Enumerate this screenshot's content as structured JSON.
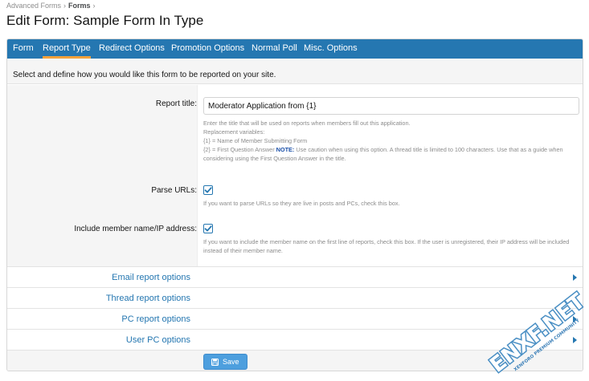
{
  "breadcrumb": {
    "items": [
      "Advanced Forms",
      "Forms"
    ],
    "separator": "›"
  },
  "page": {
    "title": "Edit Form: Sample Form In Type"
  },
  "tabs": [
    {
      "label": "Form",
      "active": false
    },
    {
      "label": "Report Type",
      "active": true
    },
    {
      "label": "Redirect Options",
      "active": false
    },
    {
      "label": "Promotion Options",
      "active": false
    },
    {
      "label": "Normal Poll",
      "active": false
    },
    {
      "label": "Misc. Options",
      "active": false
    }
  ],
  "intro_text": "Select and define how you would like this form to be reported on your site.",
  "report_title": {
    "label": "Report title:",
    "value": "Moderator Application from {1}",
    "explain_line1": "Enter the title that will be used on reports when members fill out this application.",
    "explain_line2": "Replacement variables:",
    "explain_line3": "{1} = Name of Member Submitting Form",
    "explain_line4_pre": "{2} = First Question Answer ",
    "explain_note": "NOTE:",
    "explain_line4_post": " Use caution when using this option. A thread title is limited to 100 characters. Use that as a guide when considering using the First Question Answer in the title."
  },
  "parse_urls": {
    "label": "Parse URLs:",
    "checked": true,
    "explain": "If you want to parse URLs so they are live in posts and PCs, check this box."
  },
  "include_member": {
    "label": "Include member name/IP address:",
    "checked": true,
    "explain": "If you want to include the member name on the first line of reports, check this box. If the user is unregistered, their IP address will be included instead of their member name."
  },
  "collapsers": [
    {
      "label": "Email report options"
    },
    {
      "label": "Thread report options"
    },
    {
      "label": "PC report options"
    },
    {
      "label": "User PC options"
    }
  ],
  "save_label": "Save",
  "watermark": {
    "brand": "ENXF.NET",
    "tagline": "XENFORO PREMIUM COMMUNITY"
  },
  "colors": {
    "tabbar": "#2577b1",
    "active_tab_underline": "#f3a23b",
    "link": "#2577b1",
    "button": "#4d9fde",
    "checkmark": "#2577b1"
  }
}
